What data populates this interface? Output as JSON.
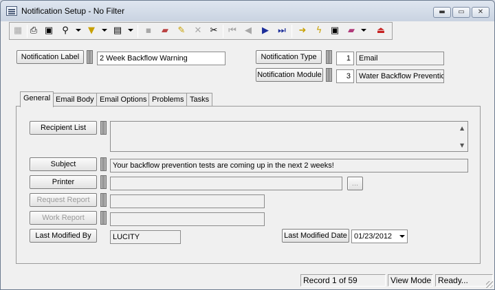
{
  "window": {
    "title": "Notification Setup - No Filter",
    "controls": {
      "minimize": "▬",
      "maximize": "▭",
      "close": "✕"
    }
  },
  "toolbar": {
    "icons": [
      "grid-icon",
      "print-icon",
      "print-preview-icon",
      "find-icon",
      "filter-icon",
      "new-document-icon",
      "save-icon",
      "books-icon",
      "edit-pencil-icon",
      "delete-icon",
      "cut-icon",
      "first-record-icon",
      "previous-record-icon",
      "next-record-icon",
      "last-record-icon",
      "go-to-icon",
      "run-icon",
      "reports-icon",
      "library-icon",
      "exit-icon"
    ]
  },
  "header": {
    "notification_label_btn": "Notification Label",
    "notification_label_value": "2 Week Backflow Warning",
    "notification_type_btn": "Notification Type",
    "notification_type_code": "1",
    "notification_type_desc": "Email",
    "notification_module_btn": "Notification Module",
    "notification_module_code": "3",
    "notification_module_desc": "Water Backflow Preventic"
  },
  "tabs": [
    "General",
    "Email Body",
    "Email Options",
    "Problems",
    "Tasks"
  ],
  "general": {
    "recipient_list_btn": "Recipient List",
    "recipient_list_value": "",
    "subject_btn": "Subject",
    "subject_value": "Your backflow prevention tests are coming up in the next 2 weeks!",
    "printer_btn": "Printer",
    "printer_value": "",
    "browse_btn": "...",
    "request_report_btn": "Request Report",
    "request_report_value": "",
    "work_report_btn": "Work Report",
    "work_report_value": "",
    "last_modified_by_btn": "Last Modified By",
    "last_modified_by_value": "LUCITY",
    "last_modified_date_btn": "Last Modified Date",
    "last_modified_date_value": "01/23/2012"
  },
  "status": {
    "record": "Record 1 of 59",
    "mode": "View Mode",
    "state": "Ready..."
  }
}
